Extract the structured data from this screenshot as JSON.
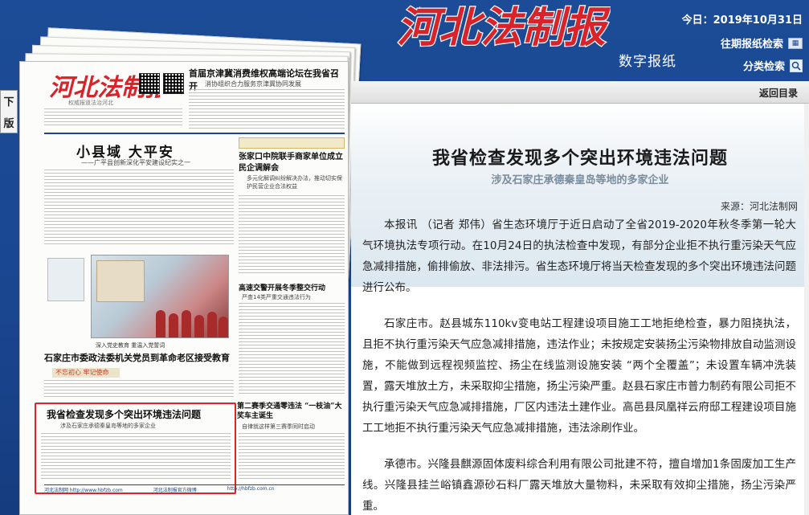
{
  "header": {
    "logo_text": "河北法制报",
    "digital_label": "数字报纸",
    "today": "今日：2019年10月31日",
    "archive_search": "往期报纸检索",
    "category_search": "分类检索"
  },
  "side_tab": {
    "line1": "下",
    "line2": "版"
  },
  "newspaper": {
    "masthead": "河北法制报",
    "masthead_sub": "权威报道法治河北",
    "top_headline": "首届京津冀消费维权高端论坛在我省召开",
    "top_headline_sub": "消协组织合力服务京津冀协同发展",
    "lead_title": "小县域 大平安",
    "lead_sub": "——广平县创新深化平安建设纪实之一",
    "side_title": "张家口中院联手商家单位成立民企调解会",
    "side_sub": "多元化解调纠纷解决办法，推动切实保护民营企业合法权益",
    "photo_caption": "深入党史教育 重温入党誓词",
    "photo_side_title": "高速交警开展冬季整交行动",
    "photo_side_sub": "严查14类严重交通违法行为",
    "mid_title": "石家庄市委政法委机关党员到革命老区接受教育",
    "ribbon": "不忘初心 牢记使命",
    "right_bottom_title": "第二赛季交通零违法 “一枝油”大奖车主诞生",
    "right_bottom_sub": "自律就这样第三赛季同时启动",
    "highlight_title": "我省检查发现多个突出环境违法问题",
    "highlight_sub": "涉及石家庄承德秦皇岛等地的多家企业",
    "footer_left": "河北法制网 http://www.hbfzb.com",
    "footer_mid": "河北法制报官方微博",
    "footer_right": "http://hbfzb.com.cn"
  },
  "article": {
    "return_label": "返回目录",
    "title": "我省检查发现多个突出环境违法问题",
    "subtitle": "涉及石家庄承德秦皇岛等地的多家企业",
    "source": "来源：河北法制网",
    "paragraphs": [
      "本报讯 （记者 郑伟）省生态环境厅于近日启动了全省2019-2020年秋冬季第一轮大气环境执法专项行动。在10月24日的执法检查中发现，有部分企业拒不执行重污染天气应急减排措施，偷排偷放、非法排污。省生态环境厅将当天检查发现的多个突出环境违法问题进行公布。",
      "石家庄市。赵县城东110kv变电站工程建设项目施工工地拒绝检查，暴力阻挠执法，且拒不执行重污染天气应急减排措施，违法作业；未按规定安装扬尘污染物排放自动监测设施，不能做到远程视频监控、扬尘在线监测设施安装 “两个全覆盖”；未设置车辆冲洗装置，露天堆放土方，未采取抑尘措施，扬尘污染严重。赵县石家庄市普力制药有限公司拒不执行重污染天气应急减排措施，厂区内违法土建作业。高邑县凤凰祥云府邸工程建设项目施工工地拒不执行重污染天气应急减排措施，违法涂刷作业。",
      "承德市。兴隆县麒源固体废料综合利用有限公司批建不符，擅自增加1条固废加工生产线。兴隆县挂兰峪镇鑫源砂石料厂露天堆放大量物料，未采取有效抑尘措施，扬尘污染严重。"
    ]
  },
  "colors": {
    "background": "#1c4c97",
    "logo_red": "#d8232a",
    "highlight_border": "#e02424"
  },
  "icons": [
    "archive-calendar-icon",
    "search-magnifier-icon"
  ]
}
